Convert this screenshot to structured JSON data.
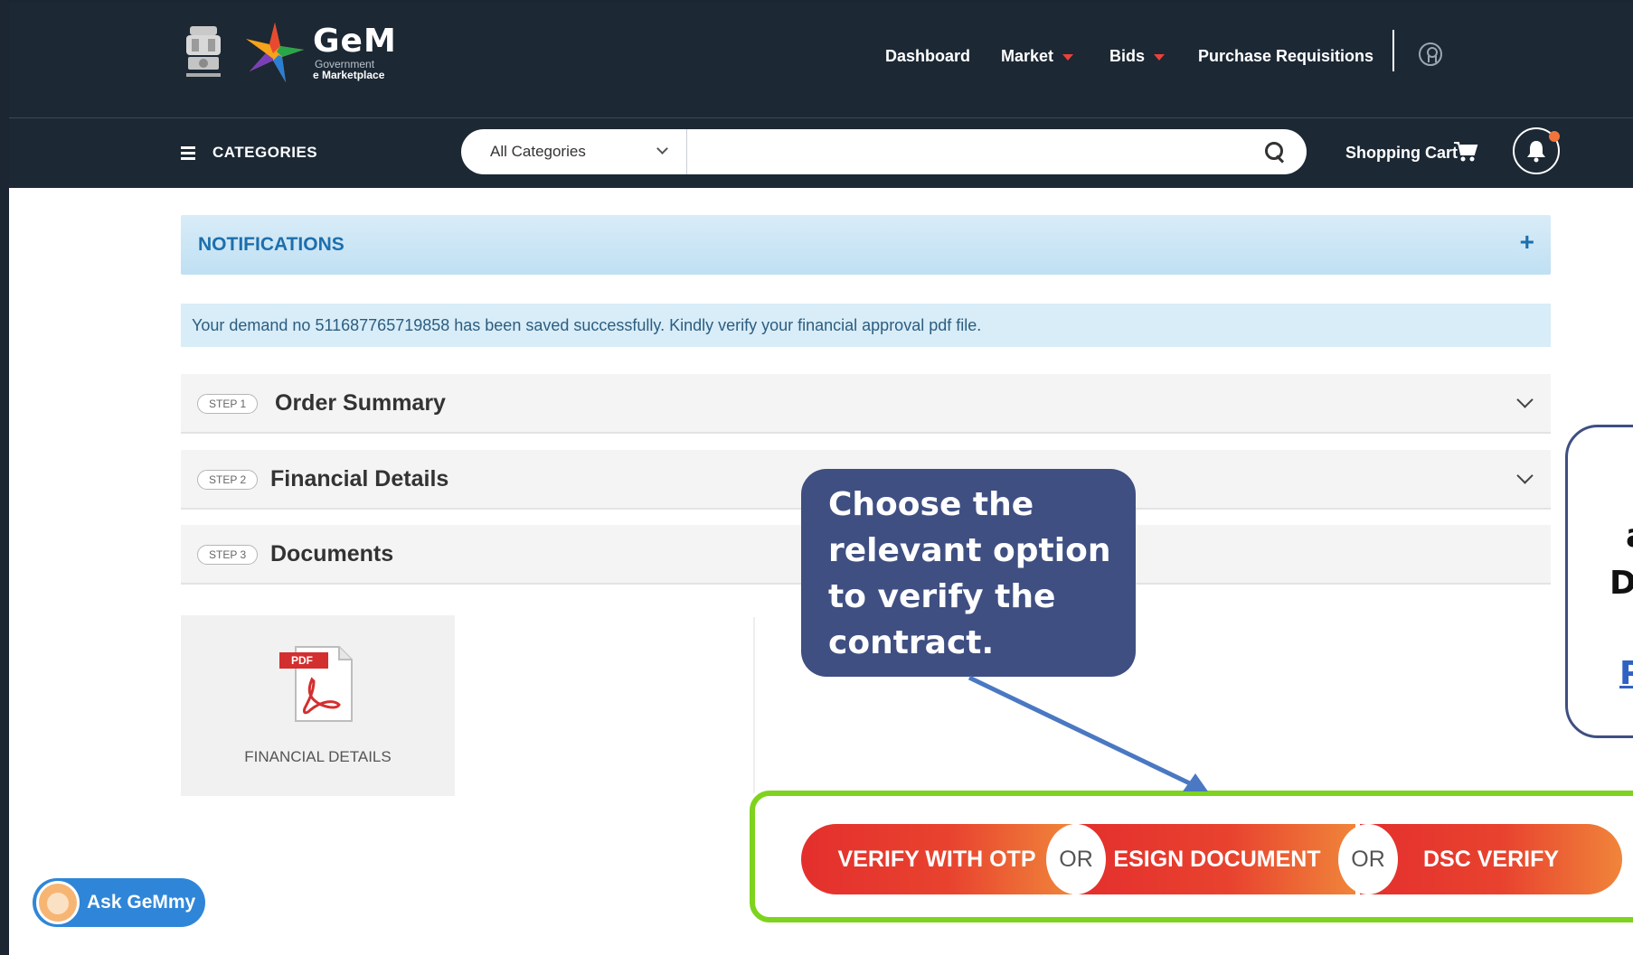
{
  "header": {
    "logo_title": "GeM",
    "logo_sub1": "Government",
    "logo_sub2": "e Marketplace",
    "nav": {
      "dashboard": "Dashboard",
      "market": "Market",
      "bids": "Bids",
      "purchase_requisitions": "Purchase Requisitions"
    }
  },
  "subheader": {
    "categories_label": "CATEGORIES",
    "category_select_value": "All Categories",
    "search_placeholder": "",
    "cart_label": "Shopping Cart"
  },
  "notifications": {
    "title": "NOTIFICATIONS",
    "expand_symbol": "+"
  },
  "alert": {
    "message": "Your demand no 511687765719858 has been saved successfully. Kindly verify your financial approval pdf file."
  },
  "steps": [
    {
      "badge": "STEP 1",
      "title": "Order Summary"
    },
    {
      "badge": "STEP 2",
      "title": "Financial Details"
    },
    {
      "badge": "STEP 3",
      "title": "Documents"
    }
  ],
  "document": {
    "pdf_badge": "PDF",
    "label": "FINANCIAL DETAILS"
  },
  "callout": {
    "text": "Choose the relevant option to verify the contract."
  },
  "side_callout": {
    "line1": "a",
    "line2": "D",
    "line3": "P"
  },
  "verify": {
    "otp": "VERIFY WITH OTP",
    "or1": "OR",
    "esign": "ESIGN DOCUMENT",
    "or2": "OR",
    "dsc": "DSC VERIFY"
  },
  "assistant": {
    "label": "Ask GeMmy"
  },
  "colors": {
    "header_bg": "#1c2834",
    "accent_red": "#e42f2d",
    "accent_orange": "#f0853a",
    "callout_bg": "#3f4f82",
    "highlight_green": "#7ed31e",
    "notification_blue": "#1d6fad"
  }
}
